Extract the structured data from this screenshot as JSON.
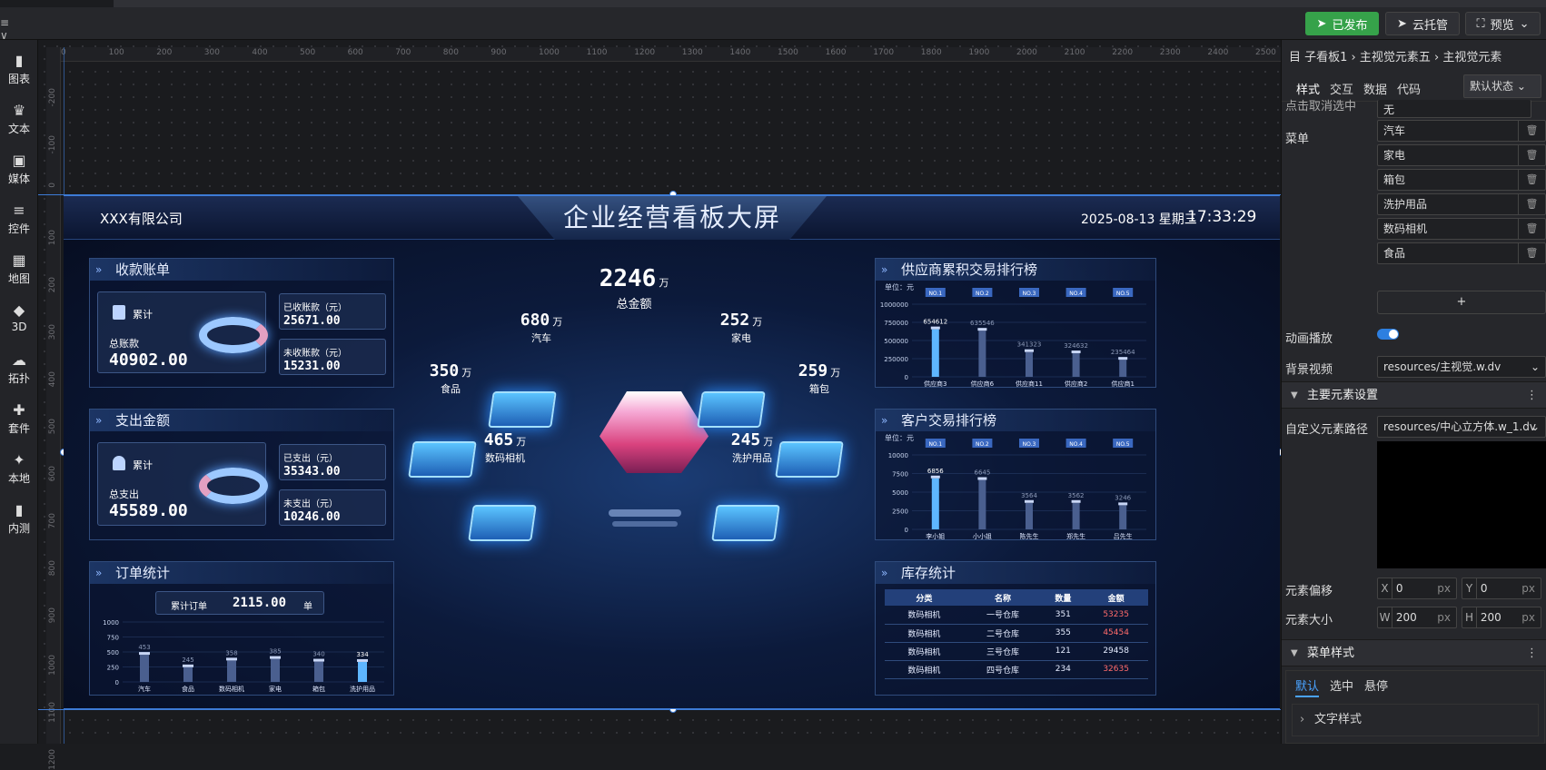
{
  "toolbar": {
    "publish": "已发布",
    "cloud": "云托管",
    "preview": "预览",
    "left_menu": "≡ ∨"
  },
  "leftbar": [
    {
      "label": "图表",
      "icon": "bar-chart-icon"
    },
    {
      "label": "文本",
      "icon": "crown-icon"
    },
    {
      "label": "媒体",
      "icon": "media-icon"
    },
    {
      "label": "控件",
      "icon": "stack-icon"
    },
    {
      "label": "地图",
      "icon": "map-icon"
    },
    {
      "label": "3D",
      "icon": "cube-icon"
    },
    {
      "label": "拓扑",
      "icon": "topology-icon"
    },
    {
      "label": "套件",
      "icon": "shirt-icon"
    },
    {
      "label": "本地",
      "icon": "puzzle-icon"
    },
    {
      "label": "内测",
      "icon": "chart-icon"
    }
  ],
  "ruler": {
    "h": [
      "0",
      "100",
      "200",
      "300",
      "400",
      "500",
      "600",
      "700",
      "800",
      "900",
      "1000",
      "1100",
      "1200",
      "1300",
      "1400",
      "1500",
      "1600",
      "1700",
      "1800",
      "1900",
      "2000",
      "2100",
      "2200",
      "2300",
      "2400",
      "2500"
    ],
    "v": [
      "-200",
      "-100",
      "0",
      "100",
      "200",
      "300",
      "400",
      "500",
      "600",
      "700",
      "800",
      "900",
      "1000",
      "1100",
      "1200"
    ]
  },
  "dashboard": {
    "company": "XXX有限公司",
    "title": "企业经营看板大屏",
    "date": "2025-08-13 星期三",
    "time": "17:33:29",
    "receipt": {
      "title": "收款账单",
      "cum": "累计",
      "total_label": "总账款",
      "total": "40902.00",
      "received_label": "已收账款（元）",
      "received": "25671.00",
      "unreceived_label": "未收账款（元）",
      "unreceived": "15231.00"
    },
    "expense": {
      "title": "支出金额",
      "cum": "累计",
      "total_label": "总支出",
      "total": "45589.00",
      "paid_label": "已支出（元）",
      "paid": "35343.00",
      "unpaid_label": "未支出（元）",
      "unpaid": "10246.00"
    },
    "orders": {
      "title": "订单统计",
      "cum_label": "累计订单",
      "cum_value": "2115.00",
      "unit": "单"
    },
    "center": {
      "total": "2246",
      "total_unit": "万",
      "total_label": "总金额",
      "items": [
        {
          "v": "680",
          "u": "万",
          "l": "汽车"
        },
        {
          "v": "252",
          "u": "万",
          "l": "家电"
        },
        {
          "v": "350",
          "u": "万",
          "l": "食品"
        },
        {
          "v": "259",
          "u": "万",
          "l": "箱包"
        },
        {
          "v": "465",
          "u": "万",
          "l": "数码相机"
        },
        {
          "v": "245",
          "u": "万",
          "l": "洗护用品"
        }
      ]
    },
    "supplier": {
      "title": "供应商累积交易排行榜",
      "unit": "单位：元"
    },
    "customer": {
      "title": "客户交易排行榜",
      "unit": "单位：元"
    },
    "stock": {
      "title": "库存统计",
      "headers": [
        "分类",
        "名称",
        "数量",
        "金额"
      ],
      "rows": [
        [
          "数码相机",
          "一号仓库",
          "351",
          "53235"
        ],
        [
          "数码相机",
          "二号仓库",
          "355",
          "45454"
        ],
        [
          "数码相机",
          "三号仓库",
          "121",
          "29458"
        ],
        [
          "数码相机",
          "四号仓库",
          "234",
          "32635"
        ]
      ]
    }
  },
  "chart_data": [
    {
      "type": "bar",
      "title": "订单统计",
      "categories": [
        "汽车",
        "食品",
        "数码相机",
        "家电",
        "箱包",
        "洗护用品"
      ],
      "values": [
        453,
        245,
        358,
        385,
        340,
        334
      ],
      "ylim": [
        0,
        1000
      ],
      "yticks": [
        "1000",
        "750",
        "500",
        "250",
        "0"
      ]
    },
    {
      "type": "bar",
      "title": "供应商累积交易排行榜",
      "categories": [
        "供应商3",
        "供应商6",
        "供应商11",
        "供应商2",
        "供应商1"
      ],
      "ranks": [
        "NO.1",
        "NO.2",
        "NO.3",
        "NO.4",
        "NO.5"
      ],
      "values": [
        654612,
        635546,
        341323,
        324632,
        235464
      ],
      "ylim": [
        0,
        1000000
      ],
      "yticks": [
        "1000000",
        "750000",
        "500000",
        "250000",
        "0"
      ]
    },
    {
      "type": "bar",
      "title": "客户交易排行榜",
      "categories": [
        "李小姐",
        "小小姐",
        "陈先生",
        "郑先生",
        "吕先生"
      ],
      "ranks": [
        "NO.1",
        "NO.2",
        "NO.3",
        "NO.4",
        "NO.5"
      ],
      "values": [
        6856,
        6645,
        3564,
        3562,
        3246
      ],
      "ylim": [
        0,
        10000
      ],
      "yticks": [
        "10000",
        "7500",
        "5000",
        "2500",
        "0"
      ]
    }
  ],
  "right": {
    "breadcrumb": "目 子看板1 › 主视觉元素五 › 主视觉元素",
    "tabs": [
      "样式",
      "交互",
      "数据",
      "代码"
    ],
    "state": "默认状态",
    "click_label": "点击取消选中",
    "click_value": "无",
    "menu_label": "菜单",
    "menu_items": [
      "汽车",
      "家电",
      "箱包",
      "洗护用品",
      "数码相机",
      "食品"
    ],
    "add": "+",
    "anim_label": "动画播放",
    "bgvideo_label": "背景视频",
    "bgvideo_value": "resources/主视觉.w.dv",
    "main_section": "主要元素设置",
    "custom_label": "自定义元素路径",
    "custom_value": "resources/中心立方体.w_1.dv",
    "offset_label": "元素偏移",
    "x_label": "X",
    "x_value": "0",
    "y_label": "Y",
    "y_value": "0",
    "px": "px",
    "size_label": "元素大小",
    "w_label": "W",
    "w_value": "200",
    "h_label": "H",
    "h_value": "200",
    "menu_style": "菜单样式",
    "style_tabs": [
      "默认",
      "选中",
      "悬停"
    ],
    "text_style": "文字样式"
  }
}
